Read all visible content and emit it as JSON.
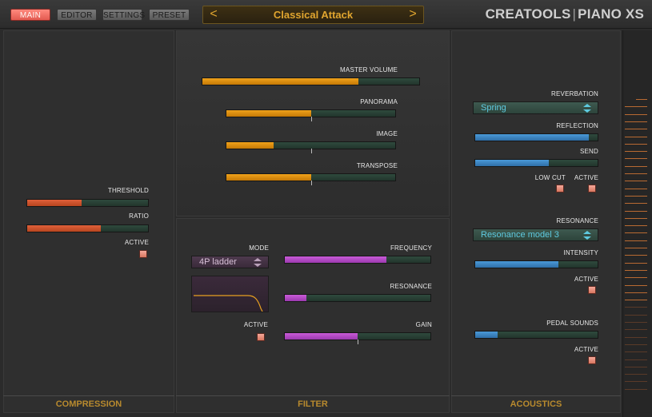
{
  "header": {
    "tabs": [
      {
        "label": "MAIN",
        "active": true
      },
      {
        "label": "EDITOR",
        "active": false
      },
      {
        "label": "SETTINGS",
        "active": false
      },
      {
        "label": "PRESET",
        "active": false
      }
    ],
    "preset_name": "Classical Attack",
    "prev_arrow": "<",
    "next_arrow": ">",
    "brand_left": "CREATOOLS",
    "brand_sep": "|",
    "brand_right": "PIANO XS"
  },
  "compression": {
    "footer": "COMPRESSION",
    "threshold": {
      "label": "THRESHOLD",
      "value": 0.45
    },
    "ratio": {
      "label": "RATIO",
      "value": 0.61
    },
    "active": {
      "label": "ACTIVE",
      "checked": true
    }
  },
  "main": {
    "master_volume": {
      "label": "MASTER VOLUME",
      "value": 0.72
    },
    "panorama": {
      "label": "PANORAMA",
      "value": 0.5
    },
    "image": {
      "label": "IMAGE",
      "value": 0.28
    },
    "transpose": {
      "label": "TRANSPOSE",
      "value": 0.5
    }
  },
  "filter": {
    "footer": "FILTER",
    "mode": {
      "label": "MODE",
      "selected": "4P ladder"
    },
    "active": {
      "label": "ACTIVE",
      "checked": true
    },
    "frequency": {
      "label": "FREQUENCY",
      "value": 0.7
    },
    "resonance": {
      "label": "RESONANCE",
      "value": 0.15
    },
    "gain": {
      "label": "GAIN",
      "value": 0.5
    }
  },
  "acoustics": {
    "footer": "ACOUSTICS",
    "reverberation": {
      "label": "REVERBATION",
      "selected": "Spring"
    },
    "reflection": {
      "label": "REFLECTION",
      "value": 0.93
    },
    "send": {
      "label": "SEND",
      "value": 0.6
    },
    "low_cut": {
      "label": "LOW CUT",
      "checked": true
    },
    "reverb_active": {
      "label": "ACTIVE",
      "checked": true
    },
    "resonance": {
      "label": "RESONANCE",
      "selected": "Resonance model 3"
    },
    "intensity": {
      "label": "INTENSITY",
      "value": 0.68
    },
    "resonance_active": {
      "label": "ACTIVE",
      "checked": true
    },
    "pedal_sounds": {
      "label": "PEDAL SOUNDS",
      "value": 0.18
    },
    "pedal_active": {
      "label": "ACTIVE",
      "checked": true
    }
  },
  "colors": {
    "orange": "#f0a21a",
    "red": "#d9582f",
    "purple": "#c95bd8",
    "blue": "#4a9ad8",
    "teal_text": "#5ecae0",
    "footer_gold": "#b88a2e"
  }
}
